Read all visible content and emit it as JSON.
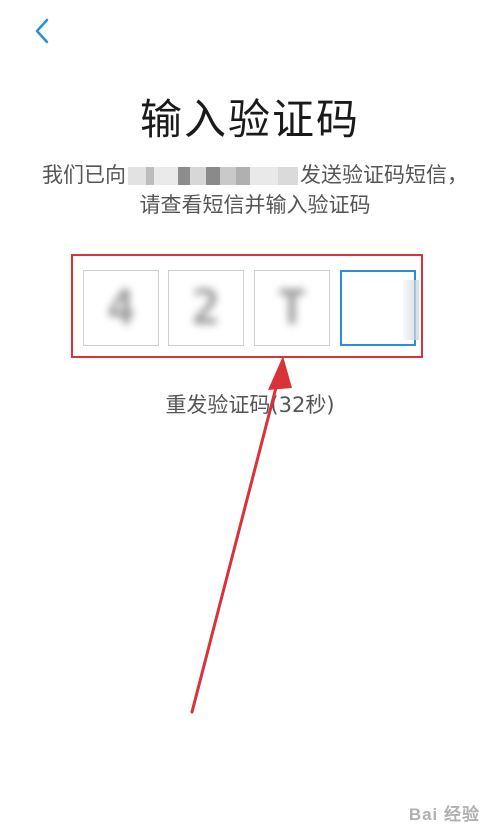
{
  "header": {
    "back_icon": "chevron-left-icon",
    "back_color": "#2b8fd6"
  },
  "title": "输入验证码",
  "subtitle": {
    "prefix": "我们已向",
    "suffix": "发送验证码短信，请查看短信并输入验证码"
  },
  "code_inputs": [
    {
      "value": "4",
      "state": "filled"
    },
    {
      "value": "2",
      "state": "filled"
    },
    {
      "value": "T",
      "state": "filled"
    },
    {
      "value": "",
      "state": "active"
    }
  ],
  "resend": "重发验证码(32秒)",
  "annotation": {
    "frame_color": "#d9333a",
    "arrow_color": "#d9333a"
  },
  "watermark": "Bai 经验"
}
